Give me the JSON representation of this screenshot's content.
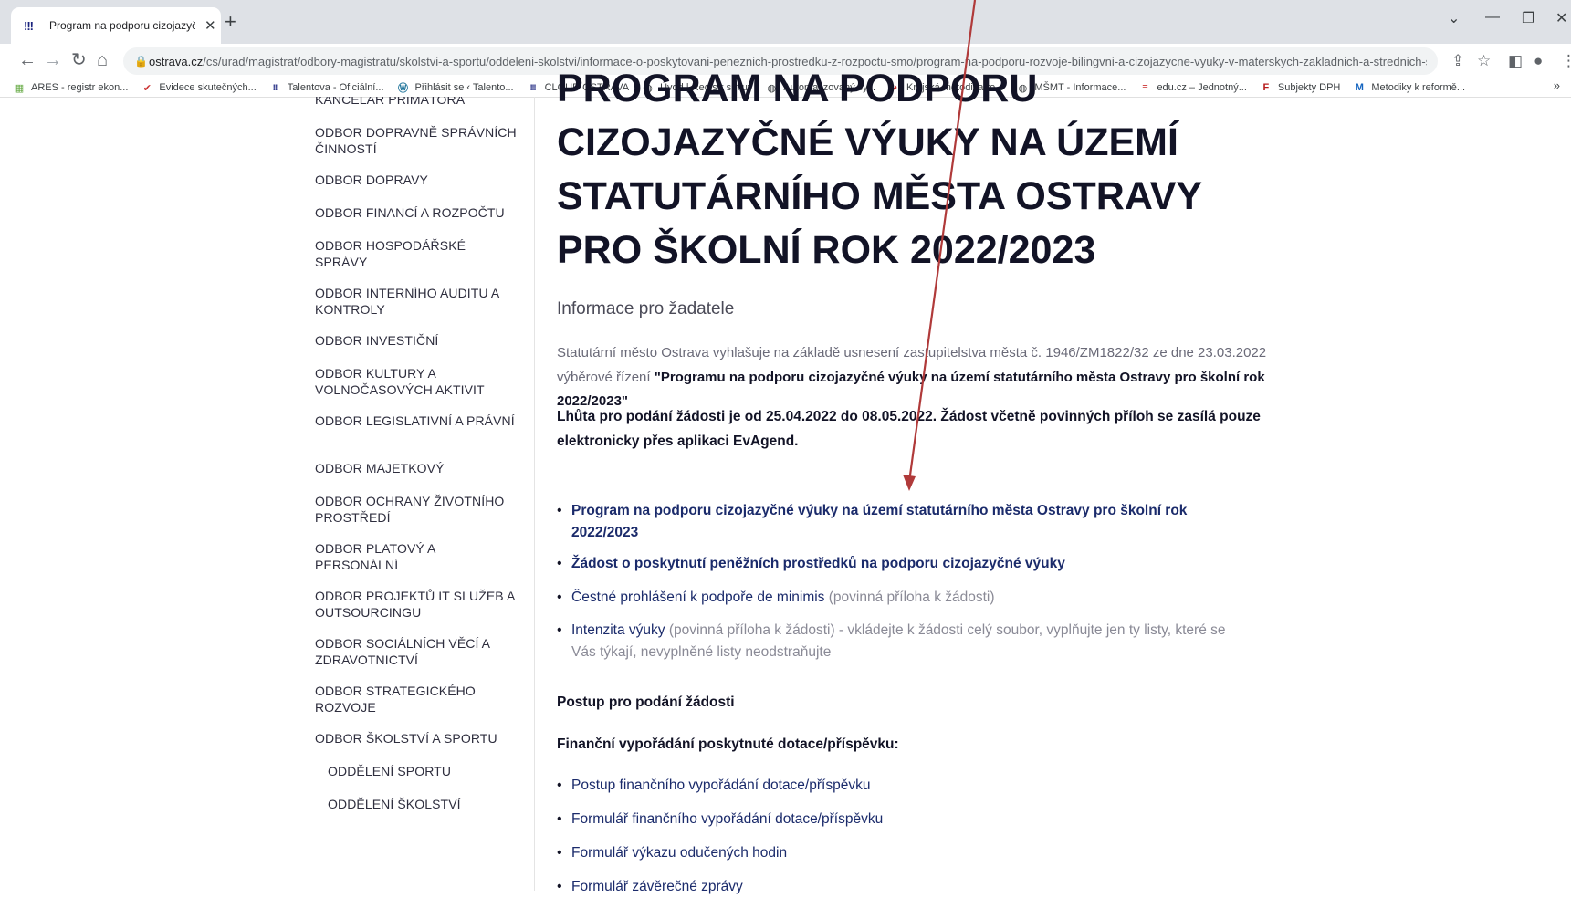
{
  "browser": {
    "tab_title": "Program na podporu cizojazyčné",
    "url_host": "ostrava.cz",
    "url_path": "/cs/urad/magistrat/odbory-magistratu/skolstvi-a-sportu/oddeleni-skolstvi/informace-o-poskytovani-peneznich-prostredku-z-rozpoctu-smo/program-na-podporu-rozvoje-bilingvni-a-cizojazycne-vyuky-v-materskych-zakladnich-a-strednich-sk...",
    "bookmarks": [
      {
        "icon": "ares-icon",
        "label": "ARES - registr ekon..."
      },
      {
        "icon": "evidence-icon",
        "label": "Evidece skutečných..."
      },
      {
        "icon": "talentova-icon",
        "label": "Talentova - Oficiální..."
      },
      {
        "icon": "wordpress-icon",
        "label": "Přihlásit se ‹ Talento..."
      },
      {
        "icon": "ostrava-icon",
        "label": "CLOUD OSTRAVA"
      },
      {
        "icon": "globe-icon",
        "label": "Úvod | Registr smluv"
      },
      {
        "icon": "globe-icon",
        "label": "Automatizovaný sy..."
      },
      {
        "icon": "krajska-icon",
        "label": "Krajská metodika ro..."
      },
      {
        "icon": "globe-icon",
        "label": "MŠMT - Informace..."
      },
      {
        "icon": "educz-icon",
        "label": "edu.cz – Jednotný..."
      },
      {
        "icon": "f-icon",
        "label": "Subjekty DPH"
      },
      {
        "icon": "m-icon",
        "label": "Metodiky k reformě..."
      }
    ],
    "bookmarks_more": "»"
  },
  "sidebar": {
    "items": [
      {
        "label": "KANCELÁŘ PRIMÁTORA"
      },
      {
        "label": "ODBOR DOPRAVNĚ SPRÁVNÍCH ČINNOSTÍ"
      },
      {
        "label": "ODBOR DOPRAVY"
      },
      {
        "label": "ODBOR FINANCÍ A ROZPOČTU"
      },
      {
        "label": "ODBOR HOSPODÁŘSKÉ SPRÁVY"
      },
      {
        "label": "ODBOR INTERNÍHO AUDITU A KONTROLY"
      },
      {
        "label": "ODBOR INVESTIČNÍ"
      },
      {
        "label": "ODBOR KULTURY A VOLNOČASOVÝCH AKTIVIT"
      },
      {
        "label": "ODBOR LEGISLATIVNÍ A PRÁVNÍ"
      },
      {
        "label": "ODBOR MAJETKOVÝ"
      },
      {
        "label": "ODBOR OCHRANY ŽIVOTNÍHO PROSTŘEDÍ"
      },
      {
        "label": "ODBOR PLATOVÝ A PERSONÁLNÍ"
      },
      {
        "label": "ODBOR PROJEKTŮ IT SLUŽEB A OUTSOURCINGU"
      },
      {
        "label": "ODBOR SOCIÁLNÍCH VĚCÍ A ZDRAVOTNICTVÍ"
      },
      {
        "label": "ODBOR STRATEGICKÉHO ROZVOJE"
      },
      {
        "label": "ODBOR ŠKOLSTVÍ A SPORTU"
      },
      {
        "label": "ODDĚLENÍ SPORTU"
      },
      {
        "label": "ODDĚLENÍ ŠKOLSTVÍ"
      }
    ]
  },
  "main": {
    "title_lines": [
      "PROGRAM NA PODPORU",
      "CIZOJAZYČNÉ VÝUKY NA ÚZEMÍ",
      "STATUTÁRNÍHO MĚSTA OSTRAVY",
      "PRO ŠKOLNÍ ROK 2022/2023"
    ],
    "subheading": "Informace pro žadatele",
    "intro_text": "Statutární město Ostrava vyhlašuje na základě usnesení zastupitelstva města č. 1946/ZM1822/32 ze dne 23.03.2022 výběrové řízení",
    "intro_bold": "\"Programu na podporu cizojazyčné výuky na území statutárního města Ostravy pro školní rok 2022/2023\"",
    "deadline": "Lhůta pro podání žádosti je od 25.04.2022 do 08.05.2022. Žádost včetně povinných příloh se zasílá pouze elektronicky přes aplikaci EvAgend.",
    "documents": [
      {
        "link": "Program na podporu cizojazyčné výuky na území statutárního města Ostravy pro školní rok 2022/2023",
        "note": ""
      },
      {
        "link": "Žádost o poskytnutí peněžních prostředků na  podporu cizojazyčné výuky",
        "note": ""
      },
      {
        "link": "Čestné prohlášení k podpoře de minimis",
        "note": " (povinná příloha k žádosti)"
      },
      {
        "link": "Intenzita výuky",
        "note": " (povinná příloha k žádosti) - vkládejte k žádosti celý soubor, vyplňujte jen ty listy, které se Vás týkají, nevyplněné listy neodstraňujte"
      }
    ],
    "procedure_heading": "Postup pro podání žádosti",
    "settlement_heading": "Finanční vypořádání poskytnuté dotace/příspěvku:",
    "settlement_links": [
      {
        "link": "Postup finančního vypořádání dotace/příspěvku"
      },
      {
        "link": "Formulář finančního vypořádání dotace/příspěvku"
      },
      {
        "link": "Formulář výkazu odučených hodin"
      },
      {
        "link": "Formulář závěrečné zprávy"
      }
    ]
  },
  "annotation": {
    "color": "#b03a3a"
  }
}
